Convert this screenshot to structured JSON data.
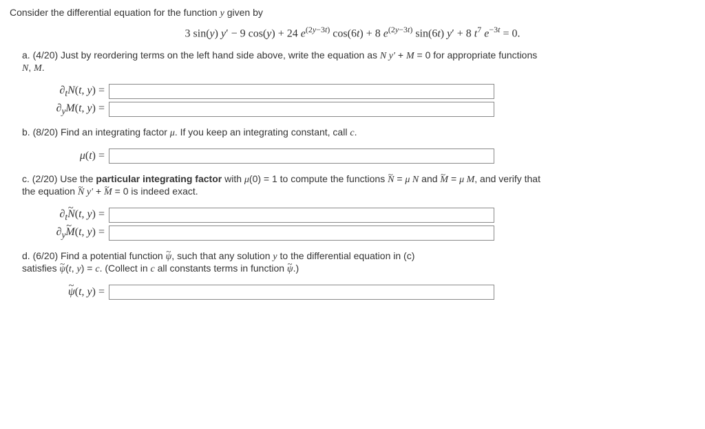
{
  "intro": "Consider the differential equation for the function y given by",
  "equation": "3 sin(y) y′ − 9 cos(y) + 24 e^(2y−3t) cos(6t) + 8 e^(2y−3t) sin(6t) y′ + 8 t^7 e^(−3t) = 0.",
  "parts": {
    "a": {
      "label": "a.",
      "points": "(4/20)",
      "text": "Just by reordering terms on the left hand side above, write the equation as N y′ + M = 0 for appropriate functions N, M.",
      "rows": [
        {
          "lhs": "∂t N(t, y) =",
          "value": ""
        },
        {
          "lhs": "∂y M(t, y) =",
          "value": ""
        }
      ]
    },
    "b": {
      "label": "b.",
      "points": "(8/20)",
      "text": "Find an integrating factor μ. If you keep an integrating constant, call c.",
      "rows": [
        {
          "lhs": "μ(t) =",
          "value": ""
        }
      ]
    },
    "c": {
      "label": "c.",
      "points": "(2/20)",
      "text_pre": "Use the ",
      "text_bold": "particular integrating factor",
      "text_post": " with μ(0) = 1 to compute the functions Ñ = μ N and M̃ = μ M, and verify that the equation Ñ y′ + M̃ = 0 is indeed exact.",
      "rows": [
        {
          "lhs": "∂t Ñ(t, y) =",
          "value": ""
        },
        {
          "lhs": "∂y M̃(t, y) =",
          "value": ""
        }
      ]
    },
    "d": {
      "label": "d.",
      "points": "(6/20)",
      "text": "Find a potential function ψ̃, such that any solution y to the differential equation in (c) satisfies ψ̃(t, y) = c. (Collect in c all constants terms in function ψ̃.)",
      "rows": [
        {
          "lhs": "ψ̃(t, y) =",
          "value": ""
        }
      ]
    }
  }
}
